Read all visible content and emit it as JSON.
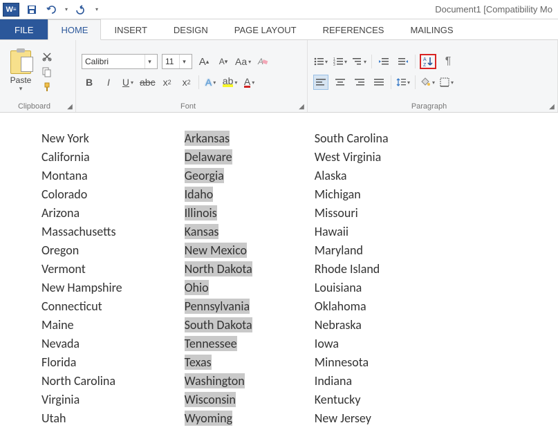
{
  "title": "Document1 [Compatibility Mo",
  "qat": {
    "word_badge": "W"
  },
  "tabs": {
    "file": "FILE",
    "home": "HOME",
    "insert": "INSERT",
    "design": "DESIGN",
    "page_layout": "PAGE LAYOUT",
    "references": "REFERENCES",
    "mailings": "MAILINGS"
  },
  "ribbon": {
    "clipboard": {
      "label": "Clipboard",
      "paste": "Paste"
    },
    "font": {
      "label": "Font",
      "name": "Calibri",
      "size": "11",
      "grow": "A",
      "shrink": "A",
      "case": "Aa",
      "bold": "B",
      "italic": "I",
      "underline": "U",
      "strike": "abc",
      "sub_x": "x",
      "sup_x": "x",
      "effects": "A",
      "highlight": "ab",
      "color": "A"
    },
    "paragraph": {
      "label": "Paragraph",
      "sort": "A↓",
      "pilcrow": "¶"
    }
  },
  "document": {
    "col1": [
      "New York",
      "California",
      "Montana",
      "Colorado",
      "Arizona",
      "Massachusetts",
      "Oregon",
      "Vermont",
      "New Hampshire",
      "Connecticut",
      "Maine",
      "Nevada",
      "Florida",
      "North Carolina",
      "Virginia",
      "Utah"
    ],
    "col2": [
      "Arkansas",
      "Delaware",
      "Georgia",
      "Idaho",
      "Illinois",
      "Kansas",
      "New Mexico",
      "North Dakota",
      "Ohio",
      "Pennsylvania",
      "South Dakota",
      "Tennessee",
      "Texas",
      "Washington",
      "Wisconsin",
      "Wyoming"
    ],
    "col3": [
      "South Carolina",
      "West Virginia",
      "Alaska",
      "Michigan",
      "Missouri",
      "Hawaii",
      "Maryland",
      "Rhode Island",
      "Louisiana",
      "Oklahoma",
      "Nebraska",
      "Iowa",
      "Minnesota",
      "Indiana",
      "Kentucky",
      "New Jersey"
    ]
  }
}
